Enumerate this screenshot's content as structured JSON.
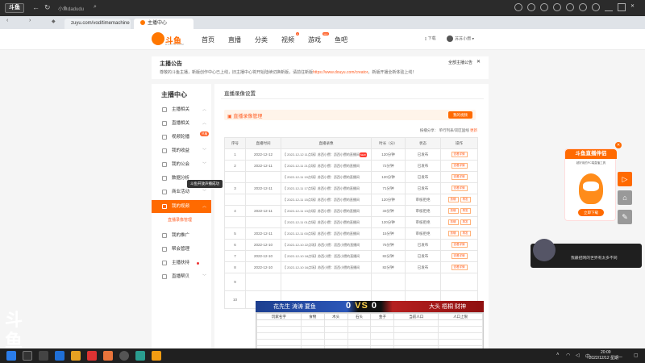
{
  "browser": {
    "logo_text": "斗鱼",
    "address_hint": "小鱼dadudu",
    "tabs": [
      {
        "label": "zuyu.com/vod/timemachine"
      },
      {
        "label": "主播中心"
      }
    ]
  },
  "header": {
    "logo_text": "斗鱼",
    "logo_sub": "DOUYU.COM",
    "nav": [
      "首页",
      "直播",
      "分类",
      "视频",
      "游戏",
      "鱼吧"
    ],
    "nav_new_tag": "new",
    "download": "下载",
    "username": "苏苏小攒"
  },
  "notice": {
    "title": "主播公告",
    "body_prefix": "尊敬的斗鱼主播，新版创作中心已上线，旧主播中心将开始陆续切换新版，请前往新版",
    "link": "https://www.douyu.com/creator",
    "body_suffix": "，新版开播全新体验上线！",
    "all_label": "全部主播公告"
  },
  "sidebar": {
    "title": "主播中心",
    "items": [
      {
        "label": "主播相关"
      },
      {
        "label": "直播相关"
      },
      {
        "label": "视频轮播"
      },
      {
        "label": "我的收益"
      },
      {
        "label": "我的公会"
      },
      {
        "label": "数据分析"
      },
      {
        "label": "商业活动"
      },
      {
        "label": "我的视频"
      },
      {
        "label": "我的推广"
      },
      {
        "label": "帮会管理"
      },
      {
        "label": "主播扶持"
      },
      {
        "label": "直播帮贝"
      }
    ],
    "sub_item": "直播录像管理",
    "hot_tag": "热播",
    "tooltip": "斗鱼开放声播成功"
  },
  "main": {
    "title": "直播录像设置",
    "rec_title": "直播录像管理",
    "rec_button": "我的视频",
    "sort_prefix": "按播分享",
    "sort_mid": "单行列表/双区固线",
    "sort_active": "更新",
    "columns": [
      "序号",
      "直播时间",
      "直播录像",
      "时长（分）",
      "状态",
      "操作"
    ],
    "rows": [
      {
        "idx": "1",
        "date": "2022-12-12",
        "title": "【 2022-12-12 11点场】苏西小攒：沥西小攒的直播间",
        "dur": "120分钟",
        "status": "已发布",
        "ops": [
          "查看详情"
        ],
        "tag": "NEW"
      },
      {
        "idx": "2",
        "date": "2022-12-11",
        "title": "【 2022-12-11 21点场】苏西小攒：沥西小攒的直播间",
        "dur": "72分钟",
        "status": "已发布",
        "ops": [
          "查看详情"
        ]
      },
      {
        "idx": "",
        "date": "",
        "title": "【 2022-12-11 19点场】苏西小攒：沥西小攒的直播间",
        "dur": "120分钟",
        "status": "已发布",
        "ops": [
          "查看详情"
        ]
      },
      {
        "idx": "3",
        "date": "2022-12-11",
        "title": "【 2022-12-11 17点场】苏西小攒：沥西小攒的直播间",
        "dur": "71分钟",
        "status": "已发布",
        "ops": [
          "查看详情"
        ]
      },
      {
        "idx": "",
        "date": "",
        "title": "【 2022-12-11 15点场】苏西小攒：沥西小攒的直播间",
        "dur": "120分钟",
        "status": "审核拒绝",
        "ops": [
          "剪辑",
          "再发"
        ]
      },
      {
        "idx": "4",
        "date": "2022-12-11",
        "title": "【 2022-12-11 13点场】苏西小攒：沥西小攒的直播间",
        "dur": "33分钟",
        "status": "审核拒绝",
        "ops": [
          "剪辑",
          "再发"
        ]
      },
      {
        "idx": "",
        "date": "",
        "title": "【 2022-12-11 01点场】苏西小攒：沥西小攒的直播间",
        "dur": "120分钟",
        "status": "审核拒绝",
        "ops": [
          "剪辑",
          "再发"
        ]
      },
      {
        "idx": "5",
        "date": "2022-12-11",
        "title": "【 2022-12-11 00点场】苏西小攒：沥西小攒的直播间",
        "dur": "15分钟",
        "status": "审核拒绝",
        "ops": [
          "剪辑",
          "再发"
        ]
      },
      {
        "idx": "6",
        "date": "2022-12-10",
        "title": "【 2022-12-10 22点场】苏西小攒：沥西小攒的直播间",
        "dur": "75分钟",
        "status": "已发布",
        "ops": [
          "查看详情"
        ]
      },
      {
        "idx": "7",
        "date": "2022-12-10",
        "title": "【 2022-12-10 18点场】苏西小攒：沥西小攒的直播间",
        "dur": "82分钟",
        "status": "已发布",
        "ops": [
          "查看详情"
        ]
      },
      {
        "idx": "8",
        "date": "2022-12-10",
        "title": "【 2022-12-10 16点场】苏西小攒：沥西小攒的直播间",
        "dur": "82分钟",
        "status": "已发布",
        "ops": [
          "查看详情"
        ]
      },
      {
        "idx": "9",
        "date": "",
        "title": "",
        "dur": "",
        "status": "",
        "ops": []
      },
      {
        "idx": "10",
        "date": "",
        "title": "",
        "dur": "",
        "status": "",
        "ops": []
      }
    ]
  },
  "overlay": {
    "left_team": "花先生 涛涛 要鱼",
    "score_left": "0",
    "vs": "VS",
    "score_right": "0",
    "right_team": "大头 梧桐 财神",
    "table_headers": [
      "玩家名字",
      "食物",
      "木头",
      "石头",
      "金子",
      "当前人口",
      "人口上限"
    ]
  },
  "banner": {
    "title": "斗鱼直播伴侣",
    "subtitle": "超好用的PC端直播工具",
    "download": "立即下载"
  },
  "toast": {
    "message": "我最招网的世界有太多不同"
  },
  "watermark": {
    "logo": "斗鱼",
    "room_id": "10029976"
  },
  "taskbar": {
    "time": "20:09",
    "date": "2022/12/12 星期一"
  }
}
